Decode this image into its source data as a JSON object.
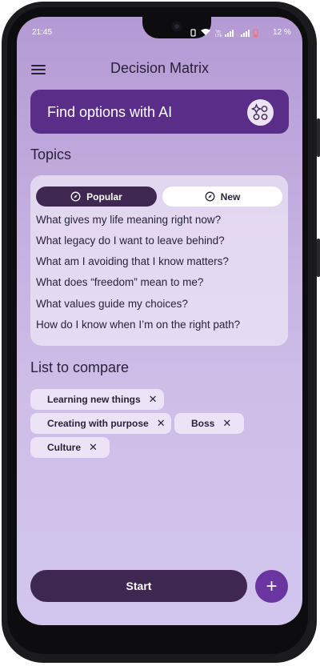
{
  "status_bar": {
    "time": "21:45",
    "battery": "12 %"
  },
  "app_bar": {
    "title": "Decision Matrix",
    "menu_icon": "hamburger-menu-icon"
  },
  "ai_banner": {
    "label": "Find options with AI",
    "icon": "ai-sparkle-icon"
  },
  "topics": {
    "heading": "Topics",
    "tabs": [
      {
        "label": "Popular",
        "icon": "compass-icon",
        "selected": true
      },
      {
        "label": "New",
        "icon": "compass-icon",
        "selected": false
      }
    ],
    "items": [
      "What gives my life meaning right now?",
      "What legacy do I want to leave behind?",
      "What am I avoiding that I know matters?",
      "What does “freedom” mean to me?",
      "What values guide my choices?",
      "How do I know when I’m on the right path?"
    ]
  },
  "compare": {
    "heading": "List to compare",
    "chips": [
      "Learning new things",
      "Creating with purpose",
      "Boss",
      "Culture"
    ],
    "remove_symbol": "✕"
  },
  "actions": {
    "start_label": "Start",
    "fab_symbol": "+"
  },
  "colors": {
    "accent": "#5a2d88",
    "dark": "#3e2750",
    "fab": "#6a35a0"
  }
}
